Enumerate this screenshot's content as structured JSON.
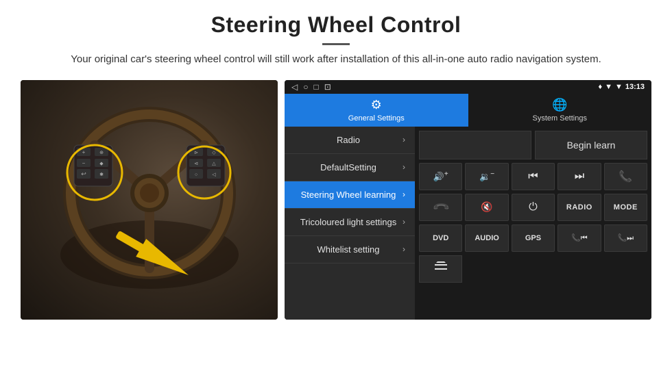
{
  "header": {
    "title": "Steering Wheel Control",
    "subtitle": "Your original car's steering wheel control will still work after installation of this all-in-one auto radio navigation system."
  },
  "status_bar": {
    "back_icon": "◁",
    "home_icon": "○",
    "square_icon": "□",
    "cast_icon": "⊡",
    "location_icon": "♦",
    "wifi_icon": "▼",
    "signal_icon": "▼",
    "time": "13:13"
  },
  "tabs": [
    {
      "id": "general",
      "label": "General Settings",
      "icon": "⚙",
      "active": true
    },
    {
      "id": "system",
      "label": "System Settings",
      "icon": "🌐",
      "active": false
    }
  ],
  "menu_items": [
    {
      "id": "radio",
      "label": "Radio",
      "active": false
    },
    {
      "id": "default",
      "label": "DefaultSetting",
      "active": false
    },
    {
      "id": "steering",
      "label": "Steering Wheel learning",
      "active": true
    },
    {
      "id": "tricolour",
      "label": "Tricoloured light settings",
      "active": false
    },
    {
      "id": "whitelist",
      "label": "Whitelist setting",
      "active": false
    }
  ],
  "controls": {
    "begin_learn_label": "Begin learn",
    "row1": [
      {
        "id": "vol-up",
        "symbol": "🔊+",
        "label": "volume up"
      },
      {
        "id": "vol-down",
        "symbol": "🔉-",
        "label": "volume down"
      },
      {
        "id": "prev-track",
        "symbol": "⏮",
        "label": "previous track"
      },
      {
        "id": "next-track",
        "symbol": "⏭",
        "label": "next track"
      },
      {
        "id": "phone",
        "symbol": "📞",
        "label": "phone"
      }
    ],
    "row2": [
      {
        "id": "hang-up",
        "symbol": "📵",
        "label": "hang up"
      },
      {
        "id": "mute",
        "symbol": "🔇",
        "label": "mute"
      },
      {
        "id": "power",
        "symbol": "⏻",
        "label": "power"
      },
      {
        "id": "radio-btn",
        "symbol": "RADIO",
        "label": "radio",
        "is_text": true
      },
      {
        "id": "mode-btn",
        "symbol": "MODE",
        "label": "mode",
        "is_text": true
      }
    ],
    "row3": [
      {
        "id": "dvd",
        "symbol": "DVD",
        "label": "dvd",
        "is_text": true
      },
      {
        "id": "audio",
        "symbol": "AUDIO",
        "label": "audio",
        "is_text": true
      },
      {
        "id": "gps",
        "symbol": "GPS",
        "label": "gps",
        "is_text": true
      },
      {
        "id": "tel-prev",
        "symbol": "📞⏮",
        "label": "tel prev"
      },
      {
        "id": "tel-next",
        "symbol": "📞⏭",
        "label": "tel next"
      }
    ],
    "row4": [
      {
        "id": "menu-icon",
        "symbol": "☰",
        "label": "menu icon"
      }
    ]
  }
}
